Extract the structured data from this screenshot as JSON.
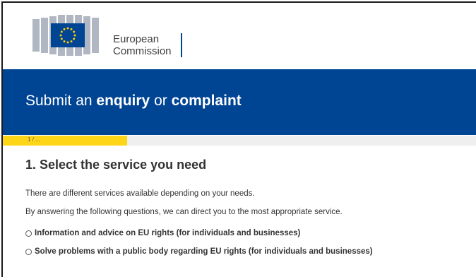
{
  "header": {
    "logo_line1": "European",
    "logo_line2": "Commission"
  },
  "banner": {
    "title_part1": "Submit an ",
    "title_bold1": "enquiry",
    "title_part2": " or ",
    "title_bold2": "complaint"
  },
  "progress": {
    "label": "1 / ...",
    "fraction": 0.26
  },
  "section": {
    "title": "1. Select the service you need",
    "intro1": "There are different services available depending on your needs.",
    "intro2": "By answering the following questions, we can direct you to the most appropriate service."
  },
  "options": [
    "Information and advice on EU rights (for individuals and businesses)",
    "Solve problems with a public body regarding EU rights (for individuals and businesses)"
  ],
  "colors": {
    "brand_blue": "#004494",
    "progress_yellow": "#ffd617",
    "flag_star": "#ffcc00"
  }
}
